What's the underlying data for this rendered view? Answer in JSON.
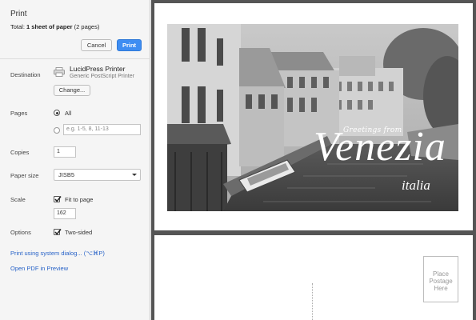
{
  "dialog": {
    "title": "Print",
    "total_label": "Total:",
    "total_value": "1 sheet of paper",
    "total_pages": "(2 pages)",
    "cancel_label": "Cancel",
    "print_label": "Print"
  },
  "destination": {
    "label": "Destination",
    "printer_name": "LucidPress Printer",
    "printer_desc": "Generic PostScript Printer",
    "change_label": "Change..."
  },
  "pages": {
    "label": "Pages",
    "all_label": "All",
    "range_placeholder": "e.g. 1-5, 8, 11-13",
    "selected": "All"
  },
  "copies": {
    "label": "Copies",
    "value": "1"
  },
  "paper_size": {
    "label": "Paper size",
    "value": "JISB5"
  },
  "scale": {
    "label": "Scale",
    "fit_label": "Fit to page",
    "fit_checked": true,
    "value": "162"
  },
  "options": {
    "label": "Options",
    "two_sided_label": "Two-sided",
    "two_sided_checked": true
  },
  "links": {
    "system_dialog": "Print using system dialog... (⌥⌘P)",
    "open_pdf": "Open PDF in Preview"
  },
  "preview": {
    "greetings": "Greetings from",
    "city": "Venezia",
    "country": "italia",
    "stamp_lines": [
      "Place",
      "Postage",
      "Here"
    ]
  },
  "icons": [
    "printer-icon",
    "checkmark-icon",
    "dropdown-arrow-icon"
  ]
}
